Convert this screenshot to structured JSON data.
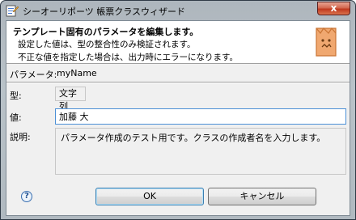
{
  "window": {
    "title": "シーオーリポーツ 帳票クラスウィザード",
    "close_glyph": "x"
  },
  "header": {
    "title": "テンプレート固有のパラメータを編集します。",
    "lines": [
      "設定した値は、型の整合性のみ検証されます。",
      "不正な値を指定した場合は、出力時にエラーになります。"
    ],
    "icon": "wizard-banner-icon"
  },
  "form": {
    "parameter_label": "パラメータ:",
    "parameter_value": "myName",
    "type_label": "型:",
    "type_value": "文字列",
    "value_label": "値:",
    "value_text": "加藤 大",
    "description_label": "説明:",
    "description_text": "パラメータ作成のテスト用です。クラスの作成者名を入力します。"
  },
  "footer": {
    "help_glyph": "?",
    "ok_label": "OK",
    "cancel_label": "キャンセル"
  },
  "colors": {
    "title_bar": "#b9c2c8",
    "close_button": "#c0391f",
    "dialog_bg": "#f0f0f0",
    "input_focus_border": "#4b8fd6",
    "banner_icon": "#e9a06a"
  }
}
